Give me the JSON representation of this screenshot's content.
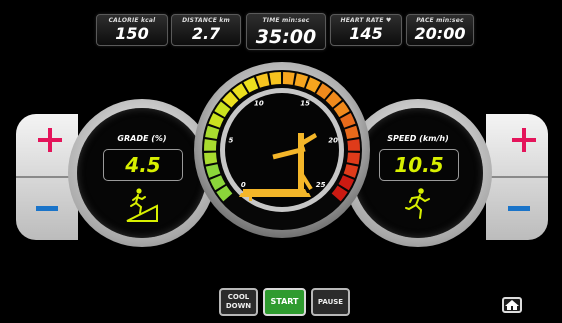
{
  "stats": {
    "calorie": {
      "label": "CALORIE kcal",
      "value": "150"
    },
    "distance": {
      "label": "DISTANCE km",
      "value": "2.7"
    },
    "time": {
      "label": "TIME min:sec",
      "value": "35:00"
    },
    "heart_rate": {
      "label": "HEART RATE ♥",
      "value": "145"
    },
    "pace": {
      "label": "PACE min:sec",
      "value": "20:00"
    }
  },
  "grade": {
    "label": "GRADE (%)",
    "value": "4.5"
  },
  "speed": {
    "label": "SPEED (km/h)",
    "value": "10.5"
  },
  "gauge": {
    "ticks": [
      "0",
      "5",
      "10",
      "15",
      "20",
      "25"
    ],
    "segment_colors": [
      "#8bd63a",
      "#a9dc2f",
      "#cbe21f",
      "#ecdf1e",
      "#f7c41f",
      "#f6a51e",
      "#f08a1c",
      "#e86a1b",
      "#df3b1a",
      "#cc1a12"
    ]
  },
  "controls": {
    "cool_down": "COOL DOWN",
    "start": "START",
    "pause": "PAUSE"
  },
  "icons": {
    "plus": "plus-icon",
    "minus": "minus-icon",
    "incline": "incline-runner-icon",
    "runner": "runner-icon",
    "treadmill": "treadmill-icon",
    "home": "home-icon"
  },
  "colors": {
    "accent_value": "#d8f000",
    "treadmill": "#f4b629",
    "plus": "#e4145a",
    "minus": "#1a74c9",
    "start": "#2f9b2f"
  }
}
